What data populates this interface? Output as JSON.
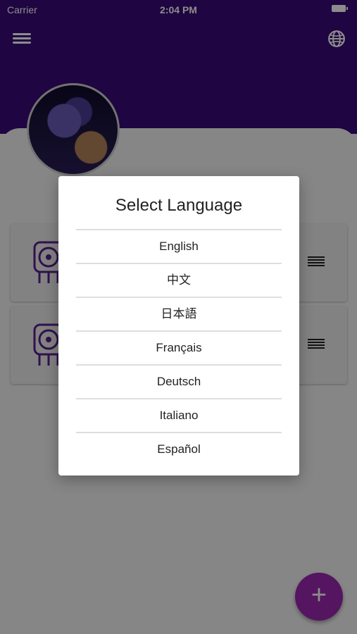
{
  "status_bar": {
    "carrier": "Carrier",
    "time": "2:04 PM"
  },
  "header": {
    "background_color": "#3a0a78"
  },
  "dialog": {
    "title": "Select Language",
    "languages": [
      "English",
      "中文",
      "日本語",
      "Français",
      "Deutsch",
      "Italiano",
      "Español"
    ]
  },
  "fab": {
    "label": "+",
    "color": "#9c27b0"
  }
}
